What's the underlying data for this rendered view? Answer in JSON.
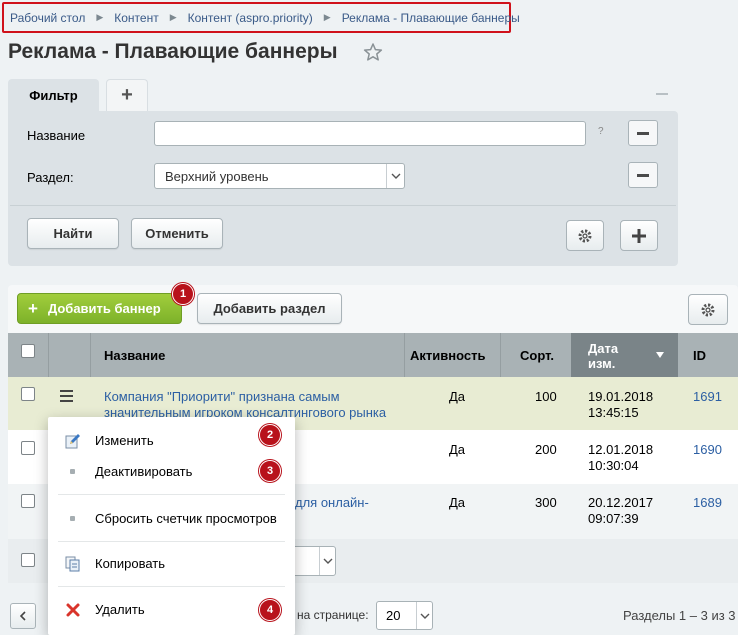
{
  "breadcrumb": [
    "Рабочий стол",
    "Контент",
    "Контент (aspro.priority)",
    "Реклама - Плавающие баннеры"
  ],
  "page": {
    "title": "Реклама - Плавающие баннеры"
  },
  "filter": {
    "tab_label": "Фильтр",
    "add_tab": "+",
    "name_label": "Название",
    "name_value": "",
    "help": "?",
    "section_label": "Раздел:",
    "section_value": "Верхний уровень",
    "find_button": "Найти",
    "cancel_button": "Отменить"
  },
  "toolbar": {
    "add_banner": "Добавить баннер",
    "add_section": "Добавить раздел",
    "accent": "#86bb2e"
  },
  "table": {
    "columns": {
      "name": "Название",
      "active": "Активность",
      "sort": "Сорт.",
      "date_line1": "Дата",
      "date_line2": "изм.",
      "id": "ID"
    },
    "rows": [
      {
        "name_line1": "Компания \"Приорити\" признана самым",
        "name_line2": "значительным игроком консалтингового рынка",
        "active": "Да",
        "sort": "100",
        "date": "19.01.2018",
        "time": "13:45:15",
        "id": "1691"
      },
      {
        "name_line1": "",
        "name_line2": "",
        "active": "Да",
        "sort": "200",
        "date": "12.01.2018",
        "time": "10:30:04",
        "id": "1690"
      },
      {
        "name_line1": "для онлайн-",
        "name_line2": "",
        "active": "Да",
        "sort": "300",
        "date": "20.12.2017",
        "time": "09:07:39",
        "id": "1689"
      }
    ]
  },
  "pagination": {
    "per_page_label": "на странице:",
    "per_page_value": "20",
    "summary": "Разделы 1 – 3 из 3"
  },
  "context_menu": {
    "items": [
      {
        "label": "Изменить",
        "icon": "edit-icon"
      },
      {
        "label": "Деактивировать",
        "icon": "dot-icon"
      },
      {
        "label": "Сбросить счетчик просмотров",
        "icon": "dot-icon"
      },
      {
        "label": "Копировать",
        "icon": "copy-icon"
      },
      {
        "label": "Удалить",
        "icon": "delete-icon"
      }
    ]
  },
  "badges": [
    "1",
    "2",
    "3",
    "4"
  ],
  "colors": {
    "highlight_border": "#d0121b",
    "badge": "#b8121b",
    "link": "#2c5fa3",
    "selected_row": "#e8ecd3"
  }
}
